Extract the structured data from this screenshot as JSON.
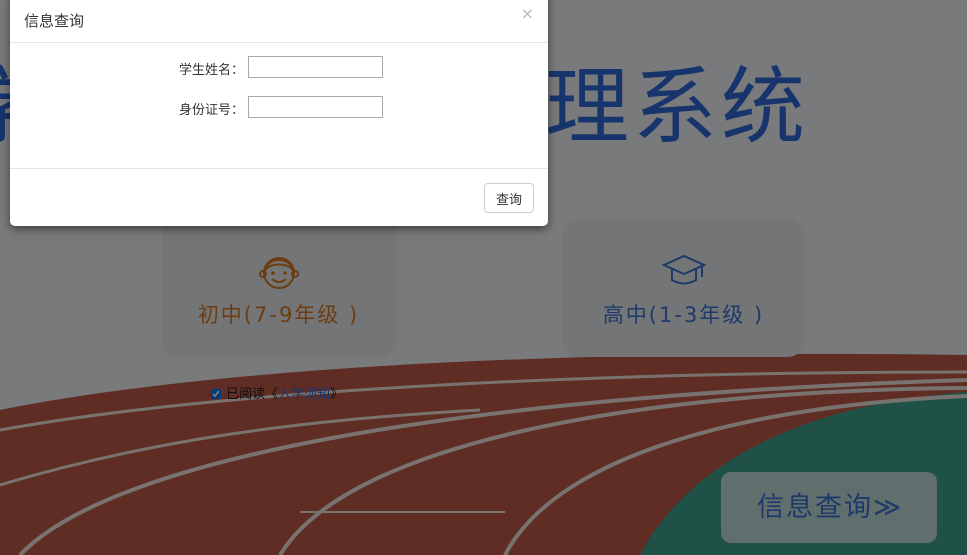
{
  "page": {
    "title_left": "学",
    "title_right": "理系统"
  },
  "cards": {
    "junior": {
      "label": "初中(7-9年级 )",
      "icon": "smiley-face-icon",
      "color": "#d97a21"
    },
    "senior": {
      "label": "高中(1-3年级 )",
      "icon": "graduation-cap-icon",
      "color": "#3c74d2"
    }
  },
  "agreement": {
    "prefix": "已阅读《",
    "link": "入学须知",
    "suffix": "》",
    "checked": true
  },
  "query_button": {
    "label": "信息查询≫"
  },
  "modal": {
    "title": "信息查询",
    "close": "×",
    "fields": {
      "name_label": "学生姓名：",
      "name_value": "",
      "id_label": "身份证号：",
      "id_value": ""
    },
    "submit_label": "查询"
  },
  "colors": {
    "accent_blue": "#2f6bd8",
    "accent_orange": "#d97a21"
  }
}
